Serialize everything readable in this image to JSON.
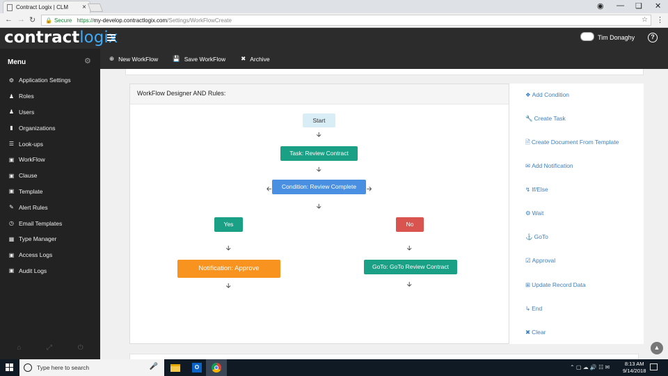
{
  "browser": {
    "tab_title": "Contract Logix | CLM",
    "secure_label": "Secure",
    "url_scheme": "https://",
    "url_host": "my-develop.contractlogix.com",
    "url_path": "/Settings/WorkFlowCreate"
  },
  "app": {
    "logo_part1": "contract",
    "logo_part2": "logix",
    "user_name": "Tim Donaghy",
    "help_label": "?"
  },
  "sidebar": {
    "menu_title": "Menu",
    "items": [
      {
        "label": "Application Settings",
        "icon": "cogs-icon"
      },
      {
        "label": "Roles",
        "icon": "users-icon"
      },
      {
        "label": "Users",
        "icon": "user-icon"
      },
      {
        "label": "Organizations",
        "icon": "building-icon"
      },
      {
        "label": "Look-ups",
        "icon": "list-icon"
      },
      {
        "label": "WorkFlow",
        "icon": "window-icon"
      },
      {
        "label": "Clause",
        "icon": "window-icon"
      },
      {
        "label": "Template",
        "icon": "window-icon"
      },
      {
        "label": "Alert Rules",
        "icon": "edit-icon"
      },
      {
        "label": "Email Templates",
        "icon": "clock-icon"
      },
      {
        "label": "Type Manager",
        "icon": "grid-icon"
      },
      {
        "label": "Access Logs",
        "icon": "window-icon"
      },
      {
        "label": "Audit Logs",
        "icon": "window-icon"
      }
    ]
  },
  "toolbar": {
    "new_workflow": "New WorkFlow",
    "save_workflow": "Save WorkFlow",
    "archive": "Archive"
  },
  "designer": {
    "title": "WorkFlow Designer AND Rules:",
    "nodes": {
      "start": "Start",
      "task": "Task: Review Contract",
      "condition": "Condition: Review Complete",
      "yes": "Yes",
      "no": "No",
      "notification": "Notification: Approve",
      "goto": "GoTo: GoTo Review Contract"
    },
    "colors": {
      "start": "#d9edf7",
      "task": "#1aa084",
      "condition": "#4a90e2",
      "yes": "#1aa084",
      "no": "#d9534f",
      "notification": "#f7931e",
      "goto": "#1aa084"
    }
  },
  "actions": [
    {
      "label": "Add Condition",
      "icon": "sitemap-icon"
    },
    {
      "label": "Create Task",
      "icon": "wrench-icon"
    },
    {
      "label": "Create Document From Template",
      "icon": "file-icon"
    },
    {
      "label": "Add Notification",
      "icon": "envelope-icon"
    },
    {
      "label": "If/Else",
      "icon": "bolt-icon"
    },
    {
      "label": "Wait",
      "icon": "cogs-icon"
    },
    {
      "label": "GoTo",
      "icon": "anchor-icon"
    },
    {
      "label": "Approval",
      "icon": "check-square-icon"
    },
    {
      "label": "Update Record Data",
      "icon": "plus-square-icon"
    },
    {
      "label": "End",
      "icon": "level-down-icon"
    },
    {
      "label": "Clear",
      "icon": "times-icon"
    }
  ],
  "taskbar": {
    "search_placeholder": "Type here to search",
    "time": "8:13 AM",
    "date": "9/14/2018"
  }
}
